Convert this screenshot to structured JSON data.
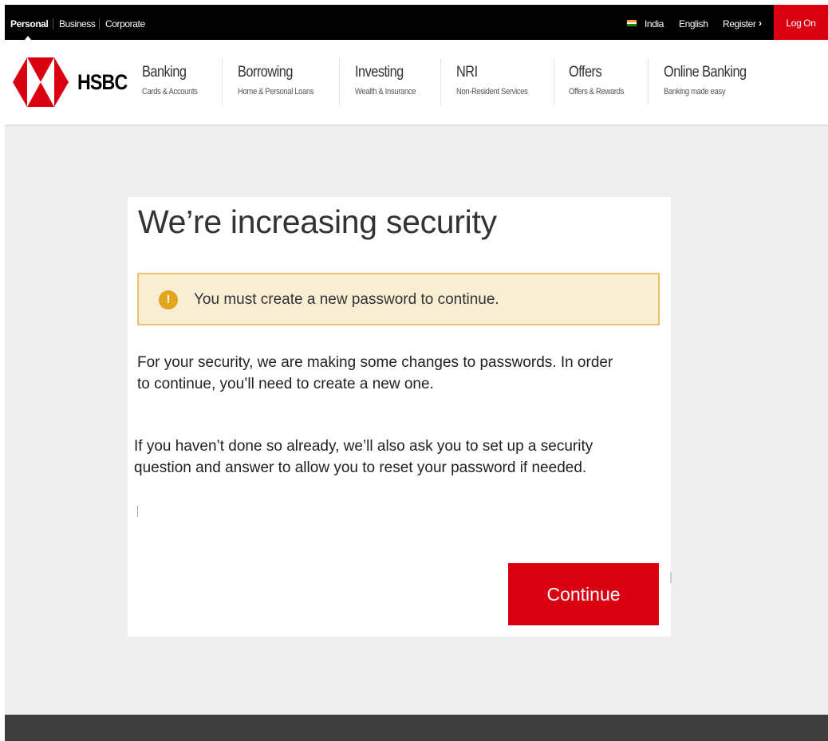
{
  "topbar": {
    "segments": [
      "Personal",
      "Business",
      "Corporate"
    ],
    "country": "India",
    "language": "English",
    "register": "Register",
    "logon": "Log On",
    "flag_colors": [
      "#ff9933",
      "#ffffff",
      "#138808"
    ]
  },
  "header": {
    "brand": "HSBC",
    "nav": [
      {
        "title": "Banking",
        "subtitle": "Cards & Accounts"
      },
      {
        "title": "Borrowing",
        "subtitle": "Home & Personal Loans"
      },
      {
        "title": "Investing",
        "subtitle": "Wealth & Insurance"
      },
      {
        "title": "NRI",
        "subtitle": "Non-Resident Services"
      },
      {
        "title": "Offers",
        "subtitle": "Offers & Rewards"
      },
      {
        "title": "Online Banking",
        "subtitle": "Banking made easy"
      }
    ]
  },
  "card": {
    "title": "We’re increasing security",
    "notice": "You must create a new password to continue.",
    "paragraph1": "For your security, we are making some changes to passwords. In order to continue, you’ll need to create a new one.",
    "paragraph2": "If you haven’t done so already, we’ll also ask you to set up a security question and answer to allow you to reset your password if needed.",
    "continue_label": "Continue"
  },
  "colors": {
    "brand_red": "#db0011",
    "notice_bg": "#f9eed4",
    "notice_border": "#e9c46a",
    "warning_icon": "#e3a51b"
  },
  "icons": [
    "hsbc-logo",
    "india-flag-icon",
    "chevron-right-icon",
    "warning-icon"
  ]
}
